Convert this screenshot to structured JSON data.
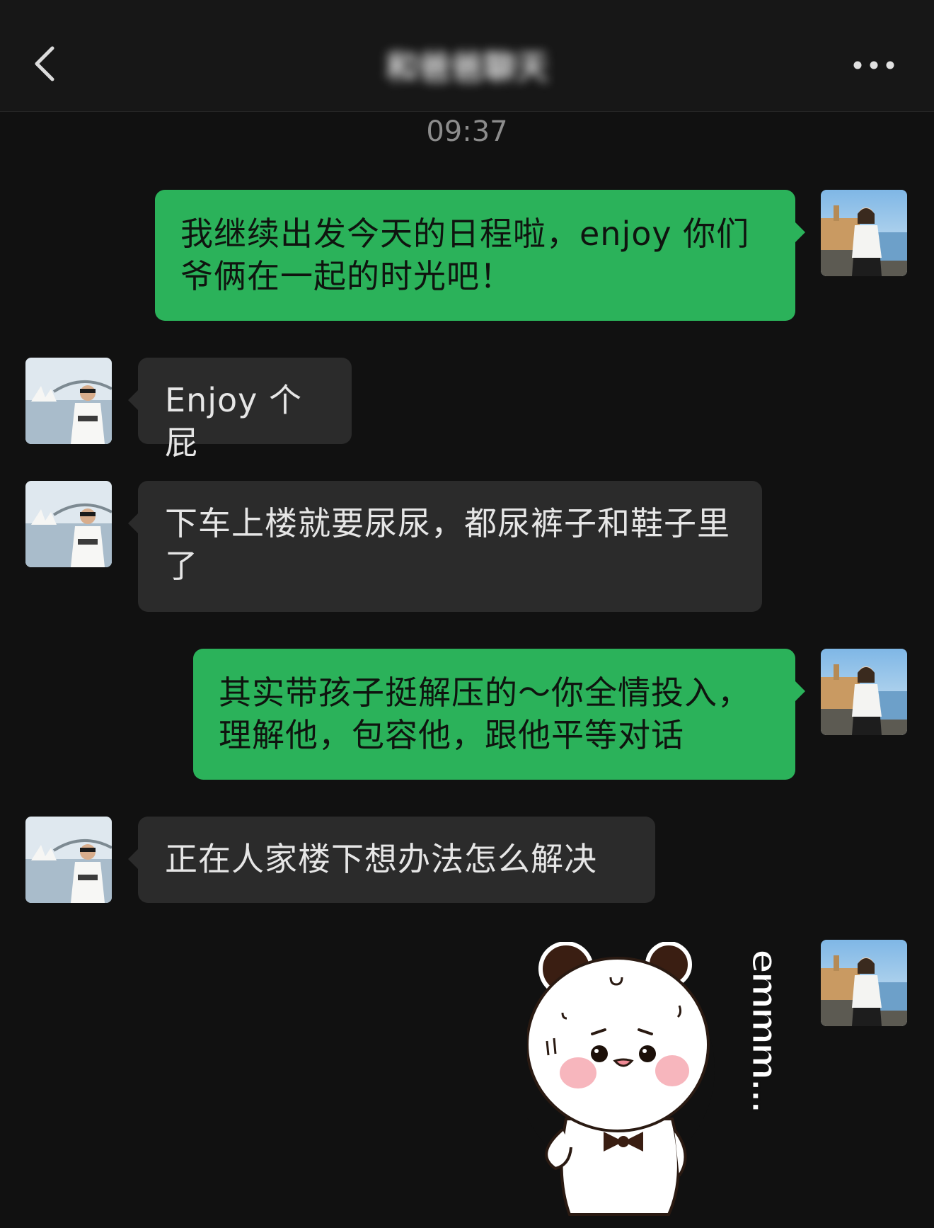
{
  "header": {
    "title": "和爸爸聊天",
    "back_icon": "chevron-left-icon",
    "more_icon": "more-horizontal-icon"
  },
  "timestamp": "09:37",
  "messages": [
    {
      "side": "out",
      "text": "我继续出发今天的日程啦，enjoy 你们爷俩在一起的时光吧！"
    },
    {
      "side": "in",
      "text": "Enjoy 个屁"
    },
    {
      "side": "in",
      "text": "下车上楼就要尿尿，都尿裤子和鞋子里了"
    },
    {
      "side": "out",
      "text": "其实带孩子挺解压的～你全情投入，理解他，包容他，跟他平等对话"
    },
    {
      "side": "in",
      "text": "正在人家楼下想办法怎么解决"
    },
    {
      "side": "out",
      "type": "sticker",
      "sticker_text": "emmm..."
    }
  ],
  "colors": {
    "background": "#111111",
    "outgoing_bubble": "#2bb25a",
    "incoming_bubble": "#2b2b2b",
    "timestamp": "#8c8c8c"
  }
}
